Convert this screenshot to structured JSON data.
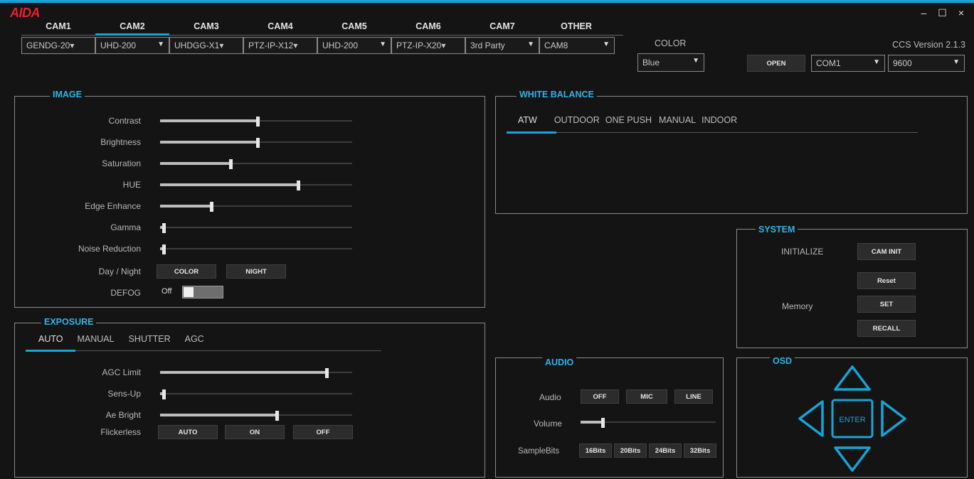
{
  "app": {
    "logo": "AIDA",
    "window_controls": [
      "–",
      "☐",
      "×"
    ],
    "version": "CCS Version 2.1.3",
    "color_label": "COLOR"
  },
  "cam_tabs": [
    "CAM1",
    "CAM2",
    "CAM3",
    "CAM4",
    "CAM5",
    "CAM6",
    "CAM7",
    "OTHER"
  ],
  "active_cam_tab": "CAM2",
  "cam_models": [
    "GENDG-20▾",
    "UHD-200",
    "UHDGG-X1▾",
    "PTZ-IP-X12▾",
    "UHD-200",
    "PTZ-IP-X20▾",
    "3rd Party",
    "CAM8"
  ],
  "color_select": "Blue",
  "connection": {
    "open_label": "OPEN",
    "port": "COM1",
    "baud": "9600"
  },
  "image": {
    "title": "IMAGE",
    "sliders": [
      {
        "label": "Contrast",
        "value": 0.5
      },
      {
        "label": "Brightness",
        "value": 0.5
      },
      {
        "label": "Saturation",
        "value": 0.36
      },
      {
        "label": "HUE",
        "value": 0.71
      },
      {
        "label": "Edge Enhance",
        "value": 0.26
      },
      {
        "label": "Gamma",
        "value": 0.01
      },
      {
        "label": "Noise Reduction",
        "value": 0.01
      }
    ],
    "day_night_label": "Day / Night",
    "day_night_buttons": [
      "COLOR",
      "NIGHT"
    ],
    "defog_label": "DEFOG",
    "defog_state": "Off"
  },
  "exposure": {
    "title": "EXPOSURE",
    "tabs": [
      "AUTO",
      "MANUAL",
      "SHUTTER",
      "AGC"
    ],
    "active_tab": "AUTO",
    "sliders": [
      {
        "label": "AGC Limit",
        "value": 0.86
      },
      {
        "label": "Sens-Up",
        "value": 0.01
      },
      {
        "label": "Ae Bright",
        "value": 0.6
      }
    ],
    "flickerless_label": "Flickerless",
    "flickerless_buttons": [
      "AUTO",
      "ON",
      "OFF"
    ]
  },
  "white_balance": {
    "title": "WHITE BALANCE",
    "tabs": [
      "ATW",
      "OUTDOOR",
      "ONE PUSH",
      "MANUAL",
      "INDOOR"
    ],
    "active_tab": "ATW"
  },
  "system": {
    "title": "SYSTEM",
    "initialize_label": "INITIALIZE",
    "cam_init": "CAM INIT",
    "memory_label": "Memory",
    "reset": "Reset",
    "set": "SET",
    "recall": "RECALL"
  },
  "audio": {
    "title": "AUDIO",
    "audio_label": "Audio",
    "audio_buttons": [
      "OFF",
      "MIC",
      "LINE"
    ],
    "volume_label": "Volume",
    "volume": 0.15,
    "samplebits_label": "SampleBits",
    "samplebits_buttons": [
      "16Bits",
      "20Bits",
      "24Bits",
      "32Bits"
    ]
  },
  "osd": {
    "title": "OSD",
    "enter": "ENTER"
  },
  "colors": {
    "accent": "#18a3d6",
    "logo": "#e8212b",
    "background": "#141414"
  }
}
